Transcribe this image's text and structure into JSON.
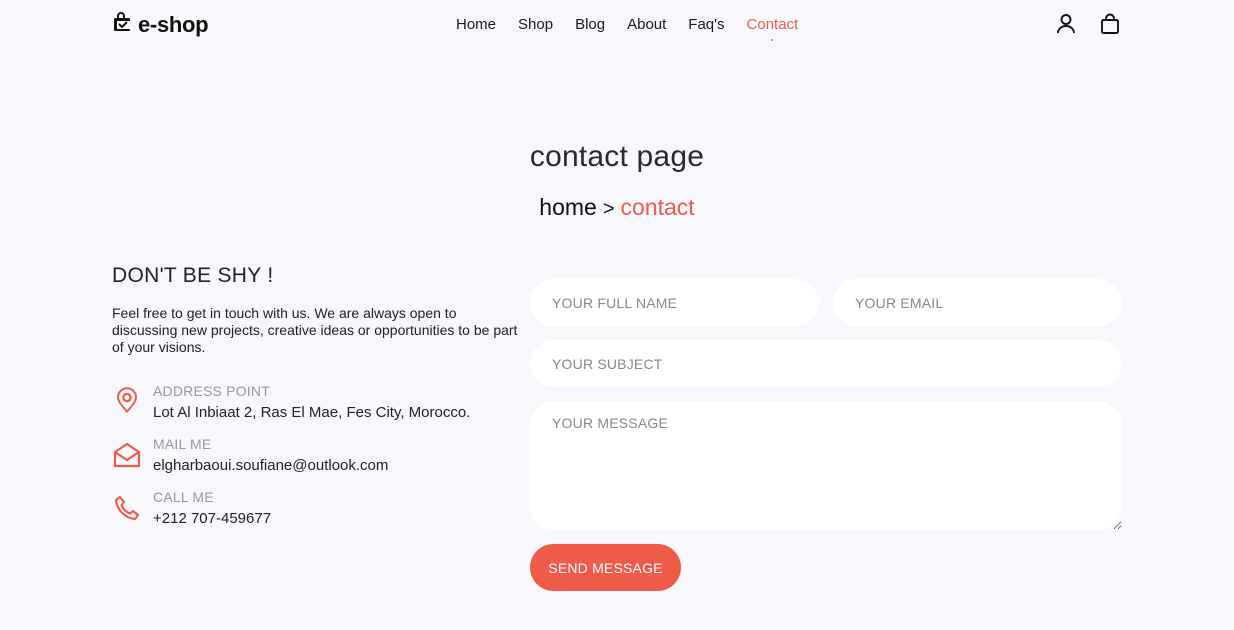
{
  "header": {
    "logo_text": "e-shop",
    "nav": [
      "Home",
      "Shop",
      "Blog",
      "About",
      "Faq's",
      "Contact"
    ],
    "active_nav": "Contact",
    "icons": [
      "user-icon",
      "shopping-bag-icon"
    ]
  },
  "hero": {
    "title": "contact page",
    "breadcrumb_home": "home",
    "breadcrumb_sep": ">",
    "breadcrumb_current": "contact"
  },
  "info": {
    "heading": "DON'T BE SHY !",
    "lead": "Feel free to get in touch with us. We are always open to discussing new projects, creative ideas or opportunities to be part of your visions.",
    "items": [
      {
        "icon": "location-pin-icon",
        "label": "ADDRESS POINT",
        "value": "Lot Al Inbiaat 2, Ras El Mae, Fes City, Morocco."
      },
      {
        "icon": "envelope-icon",
        "label": "MAIL ME",
        "value": "elgharbaoui.soufiane@outlook.com"
      },
      {
        "icon": "phone-icon",
        "label": "CALL ME",
        "value": "+212 707-459677"
      }
    ]
  },
  "form": {
    "name_placeholder": "YOUR FULL NAME",
    "email_placeholder": "YOUR EMAIL",
    "subject_placeholder": "YOUR SUBJECT",
    "message_placeholder": "YOUR MESSAGE",
    "send_label": "SEND MESSAGE"
  },
  "colors": {
    "accent": "#f05a48",
    "background": "#f7f7fc",
    "field": "#ffffff"
  }
}
